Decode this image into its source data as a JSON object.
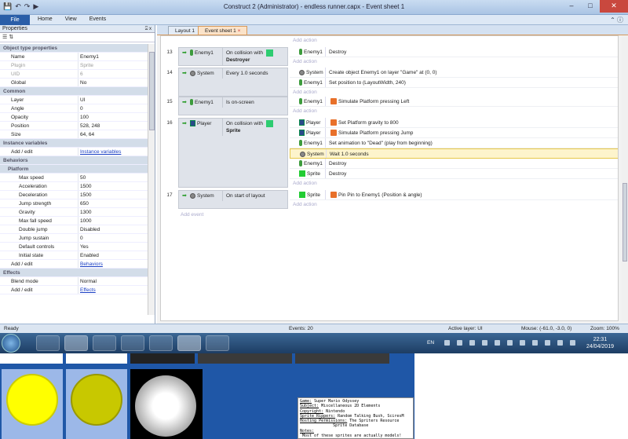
{
  "window": {
    "title": "Construct 2 (Administrator) - endless runner.capx - Event sheet 1"
  },
  "ribbon": {
    "file": "File",
    "tabs": [
      "Home",
      "View",
      "Events"
    ]
  },
  "properties": {
    "title": "Properties",
    "pin": "⍓ x",
    "rows": [
      {
        "type": "cat",
        "k": "Object type properties"
      },
      {
        "k": "Name",
        "v": "Enemy1"
      },
      {
        "k": "Plugin",
        "v": "Sprite",
        "dis": true
      },
      {
        "k": "UID",
        "v": "6",
        "dis": true
      },
      {
        "k": "Global",
        "v": "No"
      },
      {
        "type": "cat",
        "k": "Common"
      },
      {
        "k": "Layer",
        "v": "UI"
      },
      {
        "k": "Angle",
        "v": "0"
      },
      {
        "k": "Opacity",
        "v": "100"
      },
      {
        "k": "Position",
        "v": "528, 248",
        "exp": true
      },
      {
        "k": "Size",
        "v": "64, 64",
        "exp": true
      },
      {
        "type": "cat",
        "k": "Instance variables"
      },
      {
        "k": "Add / edit",
        "v": "Instance variables",
        "link": true
      },
      {
        "type": "cat",
        "k": "Behaviors"
      },
      {
        "type": "sub2",
        "k": "Platform"
      },
      {
        "type": "sub",
        "k": "Max speed",
        "v": "50"
      },
      {
        "type": "sub",
        "k": "Acceleration",
        "v": "1500"
      },
      {
        "type": "sub",
        "k": "Deceleration",
        "v": "1500"
      },
      {
        "type": "sub",
        "k": "Jump strength",
        "v": "650"
      },
      {
        "type": "sub",
        "k": "Gravity",
        "v": "1300"
      },
      {
        "type": "sub",
        "k": "Max fall speed",
        "v": "1000"
      },
      {
        "type": "sub",
        "k": "Double jump",
        "v": "Disabled"
      },
      {
        "type": "sub",
        "k": "Jump sustain",
        "v": "0"
      },
      {
        "type": "sub",
        "k": "Default controls",
        "v": "Yes"
      },
      {
        "type": "sub",
        "k": "Initial state",
        "v": "Enabled"
      },
      {
        "k": "Add / edit",
        "v": "Behaviors",
        "link": true
      },
      {
        "type": "cat",
        "k": "Effects"
      },
      {
        "k": "Blend mode",
        "v": "Normal"
      },
      {
        "k": "Add / edit",
        "v": "Effects",
        "link": true
      }
    ]
  },
  "doc_tabs": [
    "Layout 1",
    "Event sheet 1"
  ],
  "sheet": {
    "add_action": "Add action",
    "add_event": "Add event",
    "events": [
      {
        "num": "13",
        "cond": [
          {
            "obj": "Enemy1",
            "icon": "enemy",
            "txt": "On collision with",
            "txt2": "Destroyer",
            "sq": true
          }
        ],
        "acts": [
          {
            "obj": "Enemy1",
            "icon": "enemy",
            "txt": "Destroy"
          }
        ]
      },
      {
        "num": "14",
        "cond": [
          {
            "obj": "System",
            "icon": "gear",
            "txt": "Every 1.0 seconds"
          }
        ],
        "acts": [
          {
            "obj": "System",
            "icon": "gear",
            "txt": "Create object  Enemy1 on layer \"Game\" at (0, 0)"
          },
          {
            "obj": "Enemy1",
            "icon": "enemy",
            "txt": "Set position to (LayoutWidth, 240)"
          }
        ]
      },
      {
        "num": "15",
        "cond": [
          {
            "obj": "Enemy1",
            "icon": "enemy",
            "txt": "Is on-screen"
          }
        ],
        "acts": [
          {
            "obj": "Enemy1",
            "icon": "enemy",
            "txt": "Simulate  Platform pressing Left",
            "plat": true
          }
        ]
      },
      {
        "num": "16",
        "cond": [
          {
            "obj": "Player",
            "icon": "player",
            "txt": "On collision with",
            "txt2": "Sprite",
            "sq": true
          }
        ],
        "acts": [
          {
            "obj": "Player",
            "icon": "player",
            "txt": "Set  Platform gravity to 800",
            "plat": true
          },
          {
            "obj": "Player",
            "icon": "player",
            "txt": "Simulate  Platform pressing Jump",
            "plat": true
          },
          {
            "obj": "Enemy1",
            "icon": "enemy",
            "txt": "Set animation to \"Dead\" (play from beginning)"
          },
          {
            "obj": "System",
            "icon": "gear",
            "txt": "Wait 1.0 seconds",
            "hl": true
          },
          {
            "obj": "Enemy1",
            "icon": "enemy",
            "txt": "Destroy"
          },
          {
            "obj": "Sprite",
            "icon": "sprite",
            "txt": "Destroy"
          }
        ]
      },
      {
        "num": "17",
        "cond": [
          {
            "obj": "System",
            "icon": "gear",
            "txt": "On start of layout"
          }
        ],
        "acts": [
          {
            "obj": "Sprite",
            "icon": "sprite",
            "txt": "Pin Pin to  Enemy1 (Position & angle)",
            "plat": true
          }
        ]
      }
    ]
  },
  "status": {
    "ready": "Ready",
    "events": "Events: 20",
    "layer": "Active layer: UI",
    "mouse": "Mouse: (-61.0, -3.0, 0)",
    "zoom": "Zoom: 100%"
  },
  "taskbar": {
    "lang": "EN",
    "time": "22:31",
    "date": "24/04/2019"
  },
  "credits": [
    {
      "label": "Game:",
      "value": " Super Mario Odyssey"
    },
    {
      "label": "Subject:",
      "value": " Miscellaneous 2D Elements"
    },
    {
      "label": "Copyright:",
      "value": " Nintendo"
    },
    {
      "label": "Sprite Rippers:",
      "value": " Random Talking Bush, SciresM"
    },
    {
      "label": "Hosting Permissions:",
      "value": " The Spriters Resource"
    },
    {
      "label": "",
      "value": "              Sprite Database"
    },
    {
      "label": "Notes:",
      "value": " Most of these sprites are actually models!"
    }
  ]
}
